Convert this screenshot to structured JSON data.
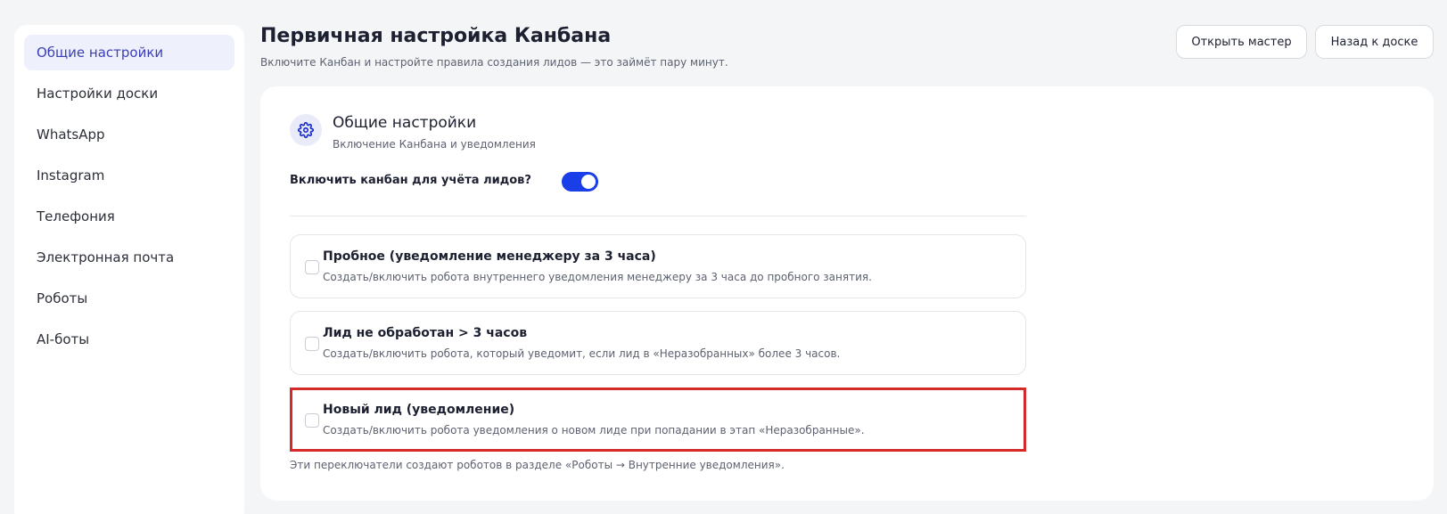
{
  "sidebar": {
    "items": [
      {
        "label": "Общие настройки",
        "active": true
      },
      {
        "label": "Настройки доски"
      },
      {
        "label": "WhatsApp"
      },
      {
        "label": "Instagram"
      },
      {
        "label": "Телефония"
      },
      {
        "label": "Электронная почта"
      },
      {
        "label": "Роботы"
      },
      {
        "label": "AI-боты"
      }
    ]
  },
  "header": {
    "title": "Первичная настройка Канбана",
    "subtitle": "Включите Канбан и настройте правила создания лидов — это займёт пару минут.",
    "open_wizard_label": "Открыть мастер",
    "back_label": "Назад к доске"
  },
  "section": {
    "icon": "gear-icon",
    "title": "Общие настройки",
    "subtitle": "Включение Канбана и уведомления",
    "toggle_label": "Включить канбан для учёта лидов?",
    "toggle_on": true
  },
  "options": [
    {
      "title": "Пробное (уведомление менеджеру за 3 часа)",
      "desc": "Создать/включить робота внутреннего уведомления менеджеру за 3 часа до пробного занятия.",
      "checked": false
    },
    {
      "title": "Лид не обработан > 3 часов",
      "desc": "Создать/включить робота, который уведомит, если лид в «Неразобранных» более 3 часов.",
      "checked": false
    },
    {
      "title": "Новый лид (уведомление)",
      "desc": "Создать/включить робота уведомления о новом лиде при попадании в этап «Неразобранные».",
      "checked": false
    }
  ],
  "footnote": "Эти переключатели создают роботов в разделе «Роботы → Внутренние уведомления».",
  "colors": {
    "accent": "#1a3ee8",
    "active_nav_bg": "#eef0fb",
    "active_nav_text": "#3a3fb5",
    "highlight_border": "#d42a2a"
  }
}
